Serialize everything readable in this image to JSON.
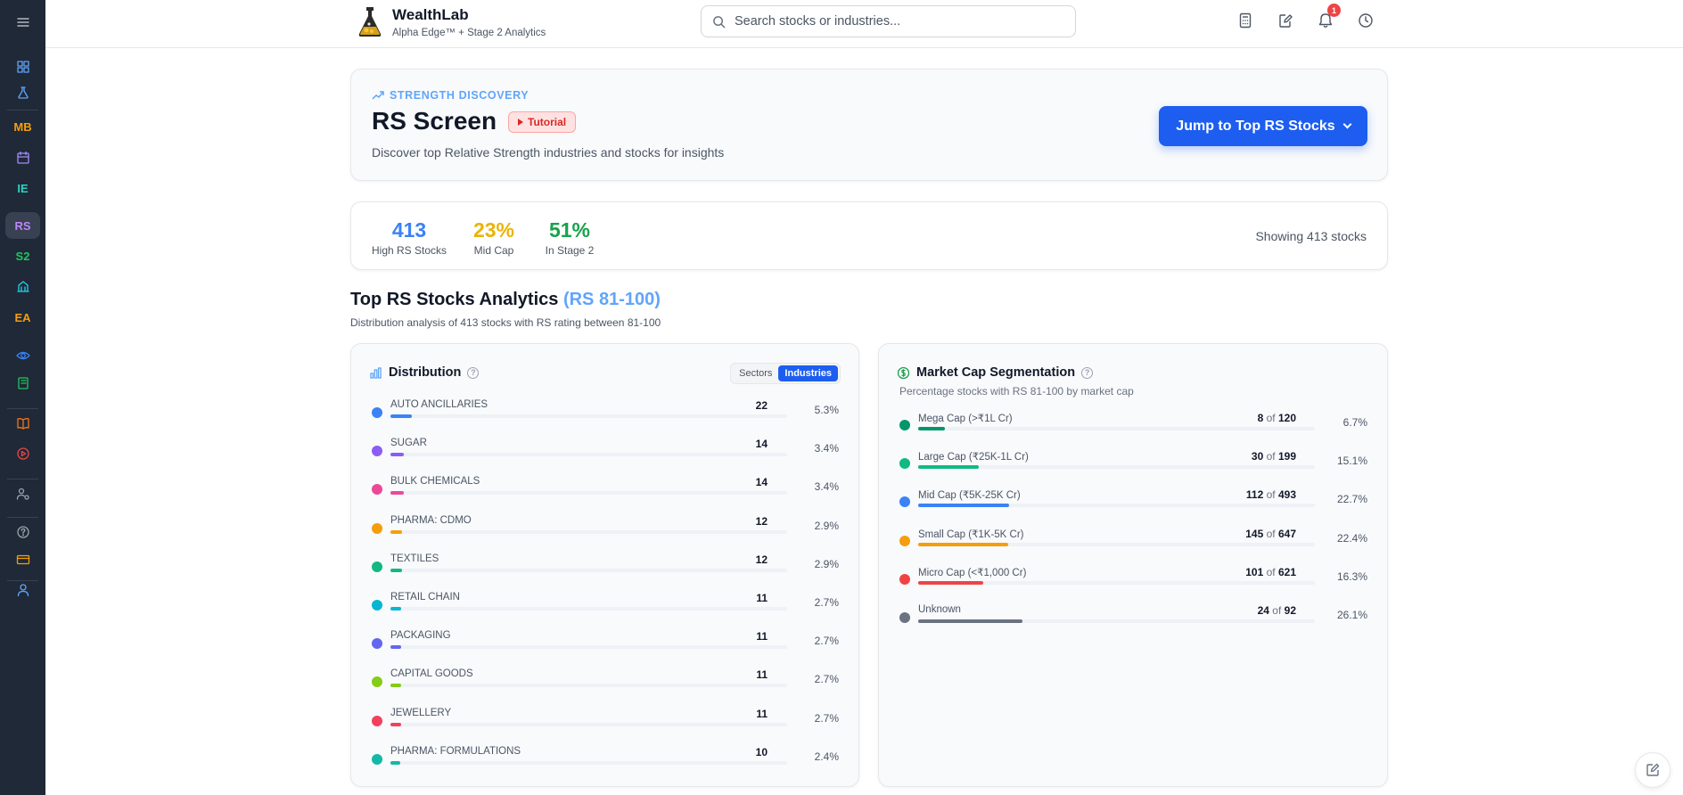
{
  "sidebar": {
    "items": [
      {
        "name": "menu-icon",
        "type": "icon",
        "color": "#d1d5db"
      },
      {
        "name": "dashboard-icon",
        "type": "icon",
        "color": "#60a5fa"
      },
      {
        "name": "flask-icon",
        "type": "icon",
        "color": "#60a5fa"
      },
      {
        "name": "sidebar-item-mb",
        "type": "text",
        "label": "MB",
        "color": "#f59e0b"
      },
      {
        "name": "calendar-icon",
        "type": "icon",
        "color": "#a78bfa"
      },
      {
        "name": "sidebar-item-ie",
        "type": "text",
        "label": "IE",
        "color": "#2dd4bf"
      },
      {
        "name": "sidebar-item-rs",
        "type": "text",
        "label": "RS",
        "color": "#c084fc",
        "active": true
      },
      {
        "name": "sidebar-item-s2",
        "type": "text",
        "label": "S2",
        "color": "#22c55e"
      },
      {
        "name": "building-icon",
        "type": "icon",
        "color": "#22d3ee"
      },
      {
        "name": "sidebar-item-ea",
        "type": "text",
        "label": "EA",
        "color": "#f59e0b"
      },
      {
        "name": "eye-icon",
        "type": "icon",
        "color": "#3b82f6"
      },
      {
        "name": "notebook-icon",
        "type": "icon",
        "color": "#22c55e"
      },
      {
        "name": "book-icon",
        "type": "icon",
        "color": "#f97316"
      },
      {
        "name": "play-circle-icon",
        "type": "icon",
        "color": "#ef4444"
      },
      {
        "name": "user-settings-icon",
        "type": "icon",
        "color": "#9ca3af"
      },
      {
        "name": "help-icon",
        "type": "icon",
        "color": "#9ca3af"
      },
      {
        "name": "card-icon",
        "type": "icon",
        "color": "#f59e0b"
      },
      {
        "name": "user-icon",
        "type": "icon",
        "color": "#60a5fa"
      }
    ]
  },
  "header": {
    "brand": "WealthLab",
    "brand_sub": "Alpha Edge™ + Stage 2 Analytics",
    "search_placeholder": "Search stocks or industries...",
    "notification_count": "1"
  },
  "hero": {
    "eyebrow": "STRENGTH DISCOVERY",
    "title": "RS Screen",
    "tutorial_label": "Tutorial",
    "description": "Discover top Relative Strength industries and stocks for insights",
    "jump_label": "Jump to Top RS Stocks"
  },
  "stats": {
    "items": [
      {
        "value": "413",
        "label": "High RS Stocks",
        "color": "#3b82f6"
      },
      {
        "value": "23%",
        "label": "Mid Cap",
        "color": "#eab308"
      },
      {
        "value": "51%",
        "label": "In Stage 2",
        "color": "#16a34a"
      }
    ],
    "showing": "Showing 413 stocks"
  },
  "section": {
    "title": "Top RS Stocks Analytics",
    "title_highlight": "(RS 81-100)",
    "subtitle": "Distribution analysis of 413 stocks with RS rating between 81-100"
  },
  "distribution": {
    "title": "Distribution",
    "toggle": [
      "Sectors",
      "Industries"
    ],
    "active_toggle": "Industries",
    "rows": [
      {
        "name": "AUTO ANCILLARIES",
        "count": "22",
        "pct": "5.3%",
        "share": 0.053,
        "color": "#3b82f6"
      },
      {
        "name": "SUGAR",
        "count": "14",
        "pct": "3.4%",
        "share": 0.034,
        "color": "#8b5cf6"
      },
      {
        "name": "BULK CHEMICALS",
        "count": "14",
        "pct": "3.4%",
        "share": 0.034,
        "color": "#ec4899"
      },
      {
        "name": "PHARMA: CDMO",
        "count": "12",
        "pct": "2.9%",
        "share": 0.029,
        "color": "#f59e0b"
      },
      {
        "name": "TEXTILES",
        "count": "12",
        "pct": "2.9%",
        "share": 0.029,
        "color": "#10b981"
      },
      {
        "name": "RETAIL CHAIN",
        "count": "11",
        "pct": "2.7%",
        "share": 0.027,
        "color": "#06b6d4"
      },
      {
        "name": "PACKAGING",
        "count": "11",
        "pct": "2.7%",
        "share": 0.027,
        "color": "#6366f1"
      },
      {
        "name": "CAPITAL GOODS",
        "count": "11",
        "pct": "2.7%",
        "share": 0.027,
        "color": "#84cc16"
      },
      {
        "name": "JEWELLERY",
        "count": "11",
        "pct": "2.7%",
        "share": 0.027,
        "color": "#f43f5e"
      },
      {
        "name": "PHARMA: FORMULATIONS",
        "count": "10",
        "pct": "2.4%",
        "share": 0.024,
        "color": "#14b8a6"
      }
    ]
  },
  "marketcap": {
    "title": "Market Cap Segmentation",
    "subtitle": "Percentage stocks with RS 81-100 by market cap",
    "of_word": "of",
    "rows": [
      {
        "name": "Mega Cap (>₹1L Cr)",
        "count": "8",
        "total": "120",
        "pct": "6.7%",
        "share": 0.067,
        "color": "#059669"
      },
      {
        "name": "Large Cap (₹25K-1L Cr)",
        "count": "30",
        "total": "199",
        "pct": "15.1%",
        "share": 0.151,
        "color": "#10b981"
      },
      {
        "name": "Mid Cap (₹5K-25K Cr)",
        "count": "112",
        "total": "493",
        "pct": "22.7%",
        "share": 0.227,
        "color": "#3b82f6"
      },
      {
        "name": "Small Cap (₹1K-5K Cr)",
        "count": "145",
        "total": "647",
        "pct": "22.4%",
        "share": 0.224,
        "color": "#f59e0b"
      },
      {
        "name": "Micro Cap (<₹1,000 Cr)",
        "count": "101",
        "total": "621",
        "pct": "16.3%",
        "share": 0.163,
        "color": "#ef4444"
      },
      {
        "name": "Unknown",
        "count": "24",
        "total": "92",
        "pct": "26.1%",
        "share": 0.261,
        "color": "#6b7280"
      }
    ]
  }
}
